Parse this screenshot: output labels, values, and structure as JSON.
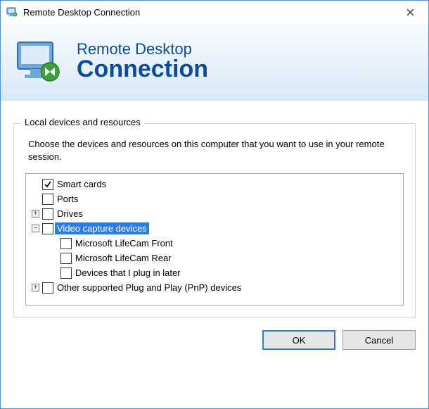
{
  "window": {
    "title": "Remote Desktop Connection",
    "banner_line1": "Remote Desktop",
    "banner_line2": "Connection"
  },
  "group": {
    "legend": "Local devices and resources",
    "description": "Choose the devices and resources on this computer that you want to use in your remote session."
  },
  "tree": {
    "items": [
      {
        "indent": 0,
        "expander": "none",
        "checked": true,
        "selected": false,
        "label": "Smart cards"
      },
      {
        "indent": 0,
        "expander": "none",
        "checked": false,
        "selected": false,
        "label": "Ports"
      },
      {
        "indent": 0,
        "expander": "plus",
        "checked": false,
        "selected": false,
        "label": "Drives"
      },
      {
        "indent": 0,
        "expander": "minus",
        "checked": false,
        "selected": true,
        "label": "Video capture devices"
      },
      {
        "indent": 1,
        "expander": "none",
        "checked": false,
        "selected": false,
        "label": "Microsoft LifeCam Front"
      },
      {
        "indent": 1,
        "expander": "none",
        "checked": false,
        "selected": false,
        "label": "Microsoft LifeCam Rear"
      },
      {
        "indent": 1,
        "expander": "none",
        "checked": false,
        "selected": false,
        "label": "Devices that I plug in later"
      },
      {
        "indent": 0,
        "expander": "plus",
        "checked": false,
        "selected": false,
        "label": "Other supported Plug and Play (PnP) devices"
      }
    ]
  },
  "buttons": {
    "ok": "OK",
    "cancel": "Cancel"
  }
}
